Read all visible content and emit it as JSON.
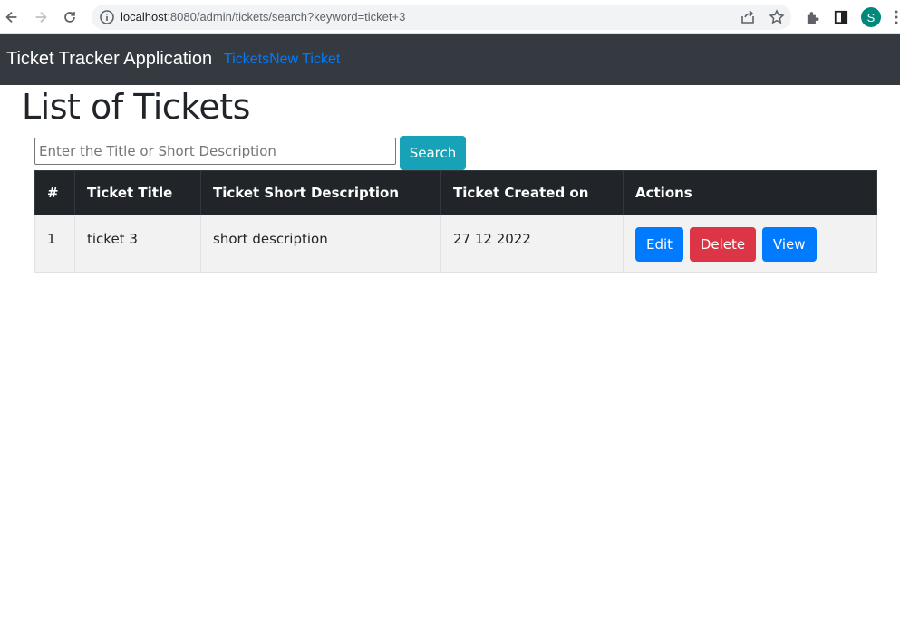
{
  "browser": {
    "url_host": "localhost",
    "url_path": ":8080/admin/tickets/search?keyword=ticket+3",
    "profile_initial": "S"
  },
  "navbar": {
    "brand": "Ticket Tracker Application",
    "links": [
      "Tickets",
      "New Ticket"
    ]
  },
  "main": {
    "title": "List of Tickets",
    "search": {
      "placeholder": "Enter the Title or Short Description",
      "value": "",
      "button_label": "Search"
    },
    "table": {
      "headers": [
        "#",
        "Ticket Title",
        "Ticket Short Description",
        "Ticket Created on",
        "Actions"
      ],
      "rows": [
        {
          "index": "1",
          "title": "ticket 3",
          "short_description": "short description",
          "created_on": "27 12 2022",
          "actions": [
            "Edit",
            "Delete",
            "View"
          ]
        }
      ]
    }
  },
  "colors": {
    "navbar_bg": "#343a40",
    "link": "#007bff",
    "search_button": "#17a2b8",
    "table_head_bg": "#212529",
    "btn_primary": "#007bff",
    "btn_danger": "#dc3545"
  }
}
